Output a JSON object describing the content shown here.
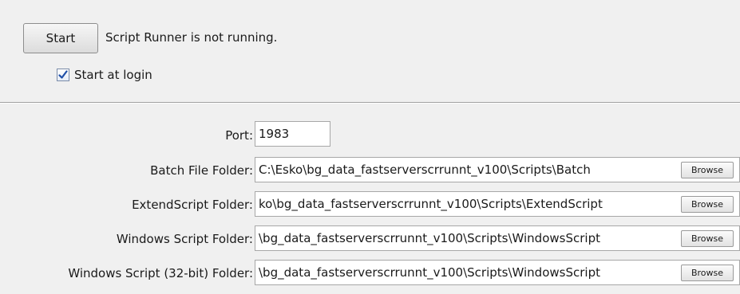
{
  "runner": {
    "start_button_label": "Start",
    "status_text": "Script Runner is not running.",
    "start_at_login_label": "Start at login",
    "start_at_login_checked": true
  },
  "settings": {
    "port": {
      "label": "Port:",
      "value": "1983"
    },
    "folders": [
      {
        "label": "Batch File Folder:",
        "value": "C:\\Esko\\bg_data_fastserverscrrunnt_v100\\Scripts\\Batch",
        "browse_label": "Browse"
      },
      {
        "label": "ExtendScript Folder:",
        "value": "ko\\bg_data_fastserverscrrunnt_v100\\Scripts\\ExtendScript",
        "browse_label": "Browse"
      },
      {
        "label": "Windows Script Folder:",
        "value": "\\bg_data_fastserverscrrunnt_v100\\Scripts\\WindowsScript",
        "browse_label": "Browse"
      },
      {
        "label": "Windows Script (32-bit) Folder:",
        "value": "\\bg_data_fastserverscrrunnt_v100\\Scripts\\WindowsScript",
        "browse_label": "Browse"
      }
    ]
  },
  "colors": {
    "background": "#f0f0f0",
    "checkmark": "#1f4fa8",
    "field_border": "#a7a7a7"
  }
}
